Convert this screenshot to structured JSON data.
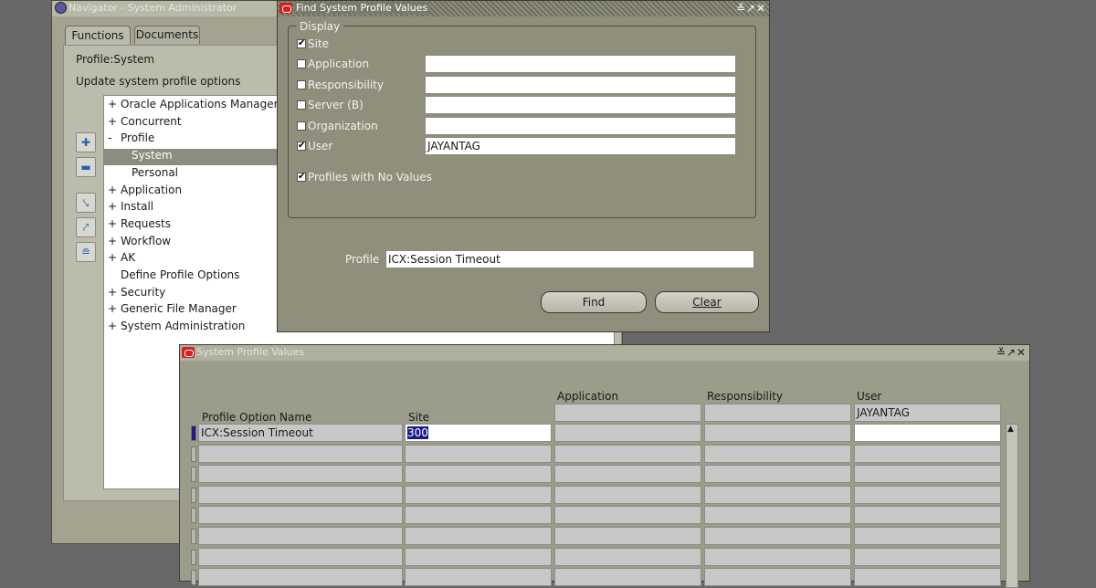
{
  "navigator": {
    "title": "Navigator - System Administrator",
    "tabs": [
      "Functions",
      "Documents"
    ],
    "context": "Profile:System",
    "description": "Update system profile options",
    "tree": [
      {
        "prefix": "+",
        "label": "Oracle Applications Manager"
      },
      {
        "prefix": "+",
        "label": "Concurrent"
      },
      {
        "prefix": "-",
        "label": "Profile"
      },
      {
        "prefix": "",
        "label": "System",
        "selected": true,
        "indent": 1
      },
      {
        "prefix": "",
        "label": "Personal",
        "indent": 1
      },
      {
        "prefix": "+",
        "label": "Application"
      },
      {
        "prefix": "+",
        "label": "Install"
      },
      {
        "prefix": "+",
        "label": "Requests"
      },
      {
        "prefix": "+",
        "label": "Workflow"
      },
      {
        "prefix": "+",
        "label": "AK"
      },
      {
        "prefix": "",
        "label": "Define Profile Options"
      },
      {
        "prefix": "+",
        "label": "Security"
      },
      {
        "prefix": "+",
        "label": "Generic File Manager"
      },
      {
        "prefix": "+",
        "label": "System Administration"
      }
    ]
  },
  "find": {
    "title": "Find System Profile Values",
    "display_group": "Display",
    "options": [
      {
        "label": "Site",
        "checked": true,
        "value": null
      },
      {
        "label": "Application",
        "checked": false,
        "value": ""
      },
      {
        "label": "Responsibility",
        "checked": false,
        "value": ""
      },
      {
        "label": "Server (B)",
        "checked": false,
        "value": ""
      },
      {
        "label": "Organization",
        "checked": false,
        "value": ""
      },
      {
        "label": "User",
        "checked": true,
        "value": "JAYANTAG"
      }
    ],
    "no_values_label": "Profiles with No Values",
    "no_values_checked": true,
    "profile_label": "Profile",
    "profile_value": "ICX:Session Timeout",
    "find_button": "Find",
    "clear_button": "Clear"
  },
  "values_window": {
    "title": "System Profile Values",
    "columns": {
      "profile_option_name": "Profile Option Name",
      "site": "Site",
      "application": "Application",
      "responsibility": "Responsibility",
      "user": "User"
    },
    "context_user": "JAYANTAG",
    "rows": [
      {
        "name": "ICX:Session Timeout",
        "site": "300",
        "application": "",
        "responsibility": "",
        "user": ""
      },
      {
        "name": "",
        "site": "",
        "application": "",
        "responsibility": "",
        "user": ""
      },
      {
        "name": "",
        "site": "",
        "application": "",
        "responsibility": "",
        "user": ""
      },
      {
        "name": "",
        "site": "",
        "application": "",
        "responsibility": "",
        "user": ""
      },
      {
        "name": "",
        "site": "",
        "application": "",
        "responsibility": "",
        "user": ""
      },
      {
        "name": "",
        "site": "",
        "application": "",
        "responsibility": "",
        "user": ""
      },
      {
        "name": "",
        "site": "",
        "application": "",
        "responsibility": "",
        "user": ""
      },
      {
        "name": "",
        "site": "",
        "application": "",
        "responsibility": "",
        "user": ""
      }
    ]
  }
}
